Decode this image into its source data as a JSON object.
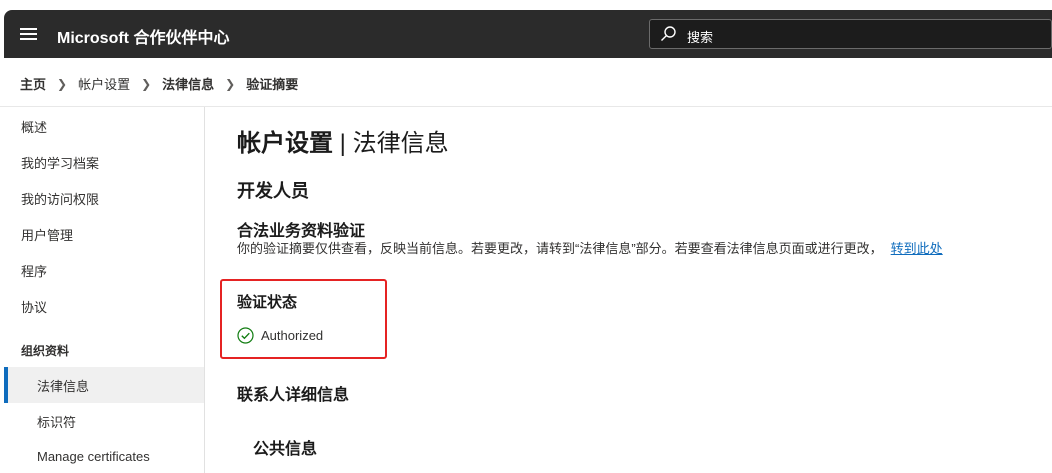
{
  "header": {
    "app_title": "Microsoft 合作伙伴中心",
    "search_placeholder": "搜索"
  },
  "breadcrumb": [
    "主页",
    "帐户设置",
    "法律信息",
    "验证摘要"
  ],
  "sidebar": {
    "items": [
      "概述",
      "我的学习档案",
      "我的访问权限",
      "用户管理",
      "程序",
      "协议"
    ],
    "group_label": "组织资料",
    "sub_items": [
      "法律信息",
      "标识符",
      "Manage certificates"
    ],
    "selected": "法律信息"
  },
  "main": {
    "title_bold": "帐户设置",
    "title_rest": " | 法律信息",
    "section": "开发人员",
    "verify_heading": "合法业务资料验证",
    "verify_desc": "你的验证摘要仅供查看，反映当前信息。若要更改，请转到“法律信息”部分。若要查看法律信息页面或进行更改，",
    "verify_link": "转到此处",
    "status_heading": "验证状态",
    "status_value": "Authorized",
    "contact_heading": "联系人详细信息",
    "public_info_heading": "公共信息"
  },
  "colors": {
    "accent": "#0f6cbd",
    "highlight_box": "#e52323",
    "success": "#107c10",
    "topbar": "#2b2b2b"
  }
}
